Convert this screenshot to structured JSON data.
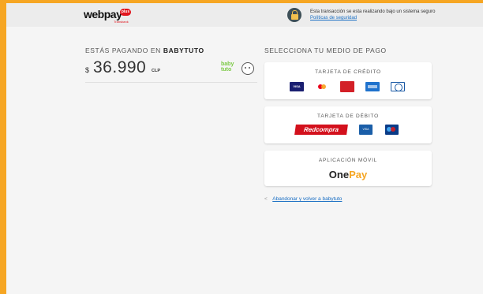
{
  "header": {
    "logo_text": "webpay",
    "logo_badge": "plus",
    "logo_sub": "Transbank",
    "secure_text": "Esta transacción se esta realizando bajo un sistema seguro",
    "security_link": "Políticas de seguridad"
  },
  "payment": {
    "paying_prefix": "ESTÁS PAGANDO EN",
    "merchant": "BABYTUTO",
    "currency_symbol": "$",
    "amount": "36.990",
    "currency_code": "CLP",
    "merchant_logo_text": "baby tuto"
  },
  "methods": {
    "title": "SELECCIONA TU MEDIO DE PAGO",
    "credit": {
      "label": "TARJETA DE CRÉDITO",
      "icons": [
        "visa-icon",
        "mastercard-icon",
        "magna-icon",
        "amex-icon",
        "diners-icon"
      ]
    },
    "debit": {
      "label": "TARJETA DE DÉBITO",
      "redcompra": "Redcompra",
      "icons": [
        "redcompra-icon",
        "visa-electron-icon",
        "maestro-icon"
      ]
    },
    "app": {
      "label": "APLICACIÓN MÓVIL",
      "brand_one": "One",
      "brand_pay": "Pay"
    }
  },
  "back_link": {
    "label": "Abandonar y volver a babytuto"
  },
  "colors": {
    "frame": "#f6a623",
    "accent_red": "#e1161e",
    "link": "#1a6fc4"
  }
}
